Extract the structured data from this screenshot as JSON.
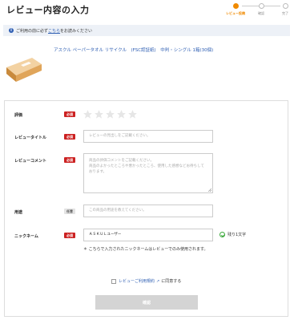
{
  "page": {
    "title": "レビュー内容の入力"
  },
  "steps": [
    {
      "label": "レビュー投稿",
      "active": true
    },
    {
      "label": "確認",
      "active": false
    },
    {
      "label": "完了",
      "active": false
    }
  ],
  "notice": {
    "prefix": "ご利用の前に必ず",
    "link": "こちら",
    "suffix": "をお読みください"
  },
  "product": {
    "name": "アスクル ペーパータオル リサイクル　(FSC認証紙)　中判・シングル 1箱(30個)"
  },
  "form": {
    "rating": {
      "label": "評価",
      "badge": "必須",
      "stars": 5,
      "value": 0
    },
    "review_title": {
      "label": "レビュータイトル",
      "badge": "必須",
      "placeholder": "レビューの見出しをご記載ください。"
    },
    "review_comment": {
      "label": "レビューコメント",
      "badge": "必須",
      "placeholder_line1": "商品の評価コメントをご記載ください。",
      "placeholder_line2": "商品のよかったところや悪かったところ、使用した感想などお待ちしております。"
    },
    "usage": {
      "label": "用途",
      "badge": "任意",
      "placeholder": "この商品の用途を教えてください。"
    },
    "nickname": {
      "label": "ニックネーム",
      "badge": "必須",
      "value": "ＡＳＫＵＬユーザー",
      "counter": "残り1文字",
      "note": "＊ こちらで入力されたニックネームはレビューでのみ使用されます。"
    }
  },
  "agreement": {
    "link": "レビューご利用規約",
    "suffix": "に同意する"
  },
  "submit": {
    "label": "確認"
  },
  "colors": {
    "accent": "#f08a00",
    "link": "#2f5fb3",
    "required": "#cc2222"
  }
}
